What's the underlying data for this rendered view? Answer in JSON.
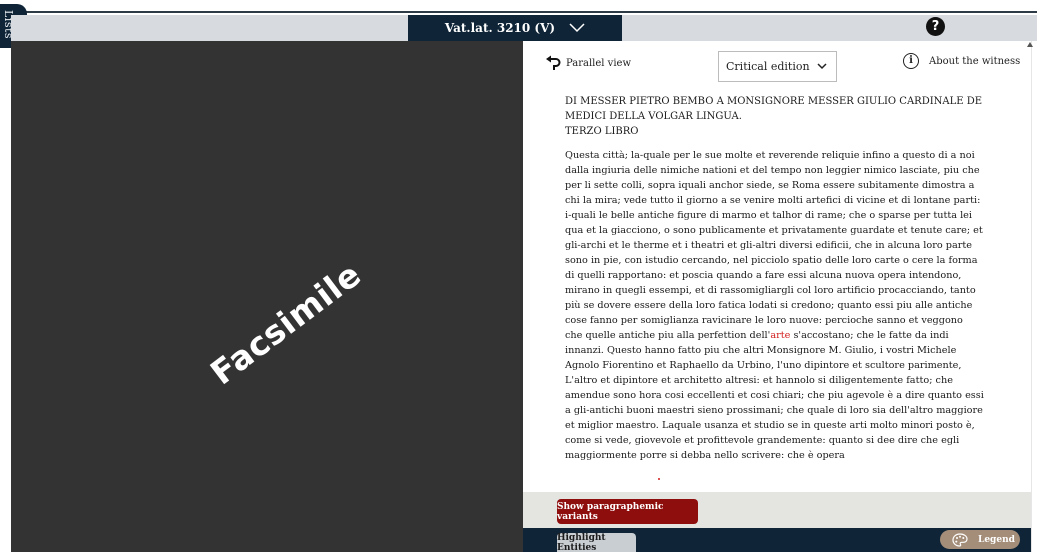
{
  "sidebar": {
    "lists_label": "Lists"
  },
  "header": {
    "witness": "Vat.lat. 3210 (V)",
    "help_symbol": "?"
  },
  "facsimile": {
    "label": "Facsimile"
  },
  "panel": {
    "parallel_view": "Parallel view",
    "edition": "Critical edition",
    "about_witness": "About the witness",
    "info_symbol": "i"
  },
  "document": {
    "title_lines": [
      "DI MESSER PIETRO BEMBO A MONSIGNORE MESSER GIULIO CARDINALE DE",
      "MEDICI DELLA VOLGAR LINGUA.",
      "TERZO LIBRO"
    ],
    "body_lines": [
      "Questa città; la-quale per le sue molte et reverende reliquie infino a questo di a noi",
      "dalla ingiuria delle nimiche nationi et del tempo non leggier nimico lasciate, piu che",
      "per li sette colli, sopra iquali anchor siede, se Roma essere subitamente dimostra a",
      "chi la mira; vede tutto il giorno a se venire molti artefici di vicine et di lontane parti:",
      "i-quali le belle antiche figure di marmo et talhor di rame; che o sparse per tutta lei",
      "qua et la giacciono, o sono publicamente et privatamente guardate et tenute care; et",
      "gli-archi et le therme et i theatri et gli-altri diversi edificii, che in alcuna loro parte",
      "sono in pie, con istudio cercando, nel picciolo spatio delle loro carte o cere la forma",
      "di quelli rapportano: et poscia quando a fare essi alcuna nuova opera intendono,",
      "mirano in quegli essempi, et di rassomigliargli col loro artificio procacciando, tanto",
      "più se dovere essere della loro fatica lodati si credono; quanto essi piu alle antiche",
      "cose fanno per somiglianza ravicinare le loro nuove: percioche sanno et veggono",
      null,
      "innanzi. Questo hanno fatto piu che altri Monsignore M. Giulio, i vostri Michele",
      "Agnolo Fiorentino et Raphaello da Urbino, l'uno dipintore et scultore parimente,",
      "L'altro et dipintore et architetto altresi: et hannolo si diligentemente fatto; che",
      "amendue sono hora cosi eccellenti et cosi chiari; che piu agevole è a dire quanto essi",
      "a gli-antichi buoni maestri sieno prossimani; che quale di loro sia dell'altro maggiore",
      "et miglior maestro. Laquale usanza et studio se in queste arti molto minori posto è,",
      "come si vede, giovevole et profittevole grandemente: quanto si dee dire che egli",
      "maggiormente porre si debba nello scrivere: che è opera"
    ],
    "line13": {
      "before": "che quelle antiche piu alla perfettion dell'",
      "entity": "arte",
      "after": " s'accostano; che le fatte da indi"
    }
  },
  "footer": {
    "variants_button": "Show paragraphemic variants",
    "highlight_button": "Highlight Entities",
    "legend_button": "Legend"
  },
  "colors": {
    "navy": "#0f2437",
    "variants_red": "#8e0d0d",
    "entity_red": "#d11a1a",
    "legend_tan": "#a48e79"
  }
}
